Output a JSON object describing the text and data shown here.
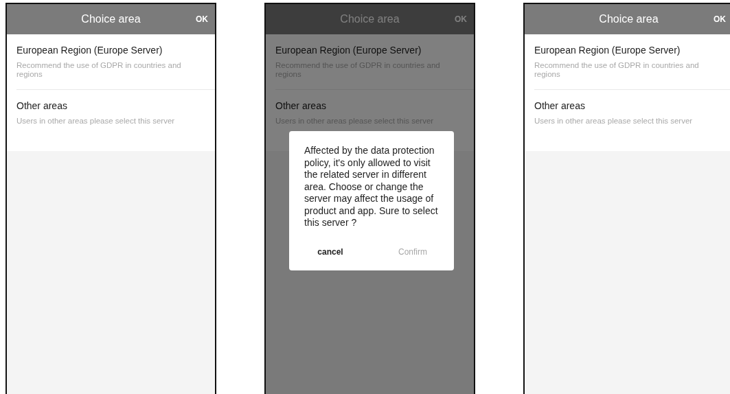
{
  "screens": [
    {
      "title": "Choice area",
      "ok": "OK",
      "dimmed": false,
      "options": [
        {
          "name": "European Region (Europe Server)",
          "description": "Recommend the use of GDPR in countries and regions"
        },
        {
          "name": "Other areas",
          "description": "Users in other areas please select this server"
        }
      ]
    },
    {
      "title": "Choice area",
      "ok": "OK",
      "dimmed": true,
      "options": [
        {
          "name": "European Region (Europe Server)",
          "description": "Recommend the use of GDPR in countries and regions"
        },
        {
          "name": "Other areas",
          "description": "Users in other areas please select this server"
        }
      ],
      "dialog": {
        "message": "Affected by the data protection policy, it's only allowed to visit the related server in different area. Choose or change the server may affect the usage of product and app. Sure to select this server ?",
        "buttons": [
          {
            "label": "cancel",
            "disabled": false
          },
          {
            "label": "Confirm",
            "disabled": true
          }
        ]
      }
    },
    {
      "title": "Choice area",
      "ok": "OK",
      "dimmed": false,
      "options": [
        {
          "name": "European Region (Europe Server)",
          "description": "Recommend the use of GDPR in countries and regions"
        },
        {
          "name": "Other areas",
          "description": "Users in other areas please select this server"
        }
      ]
    }
  ]
}
